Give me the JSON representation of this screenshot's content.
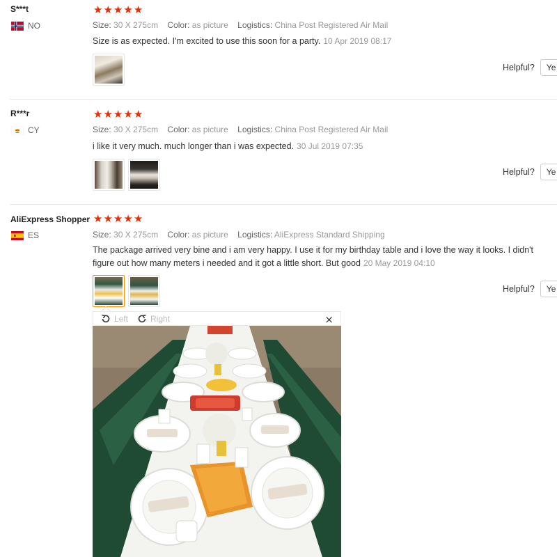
{
  "labels": {
    "size": "Size:",
    "color": "Color:",
    "logistics": "Logistics:",
    "helpful": "Helpful?",
    "yes_button": "Ye"
  },
  "reviews": [
    {
      "user": "S***t",
      "country": "NO",
      "rating": 5,
      "size": "30 X 275cm",
      "color": "as picture",
      "logistics": "China Post Registered Air Mail",
      "text": "Size is as expected. I'm excited to use this soon for a party.",
      "date": "10 Apr 2019 08:17"
    },
    {
      "user": "R***r",
      "country": "CY",
      "rating": 5,
      "size": "30 X 275cm",
      "color": "as picture",
      "logistics": "China Post Registered Air Mail",
      "text": "i like it very much. much longer than i was expected.",
      "date": "30 Jul 2019 07:35"
    },
    {
      "user": "AliExpress Shopper",
      "country": "ES",
      "rating": 5,
      "size": "30 X 275cm",
      "color": "as picture",
      "logistics": "AliExpress Standard Shipping",
      "text_line1": "The package arrived very bine and i am very happy. I use it for my birthday table and i love the way it looks. I didn't",
      "text_line2": "figure out how many meters i needed and it got a little short. But good",
      "date": "20 May 2019 04:10"
    }
  ],
  "viewer": {
    "rotate_left": "Left",
    "rotate_right": "Right",
    "close": "×"
  },
  "colors": {
    "star": "#e62e04",
    "active_thumb_border": "#ff9000",
    "muted_text": "#999999"
  }
}
